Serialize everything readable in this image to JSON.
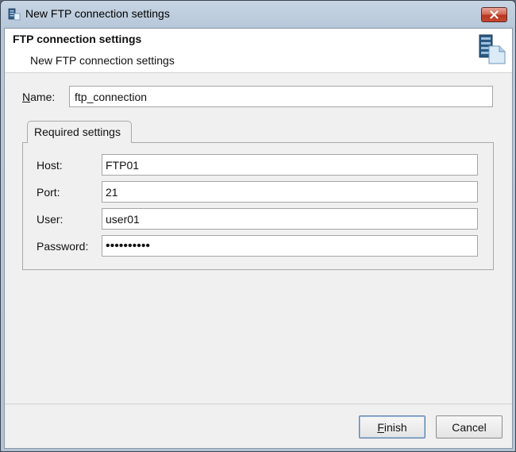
{
  "window": {
    "title": "New FTP connection settings",
    "close_icon": "close-icon"
  },
  "header": {
    "title": "FTP connection settings",
    "subtitle": "New FTP connection settings",
    "icon": "server-document-icon"
  },
  "name_field": {
    "label_mnemonic": "N",
    "label_rest": "ame:",
    "value": "ftp_connection"
  },
  "tabs": [
    {
      "label": "Required settings",
      "selected": true
    }
  ],
  "fields": {
    "host": {
      "label": "Host:",
      "value": "FTP01"
    },
    "port": {
      "label": "Port:",
      "value": "21"
    },
    "user": {
      "label": "User:",
      "value": "user01"
    },
    "password": {
      "label": "Password:",
      "value": "••••••••••"
    }
  },
  "buttons": {
    "finish_mnemonic": "F",
    "finish_rest": "inish",
    "cancel": "Cancel"
  },
  "colors": {
    "titlebar": "#b7c8da",
    "close_button": "#c8472e",
    "dialog_background": "#f0f0f0"
  }
}
